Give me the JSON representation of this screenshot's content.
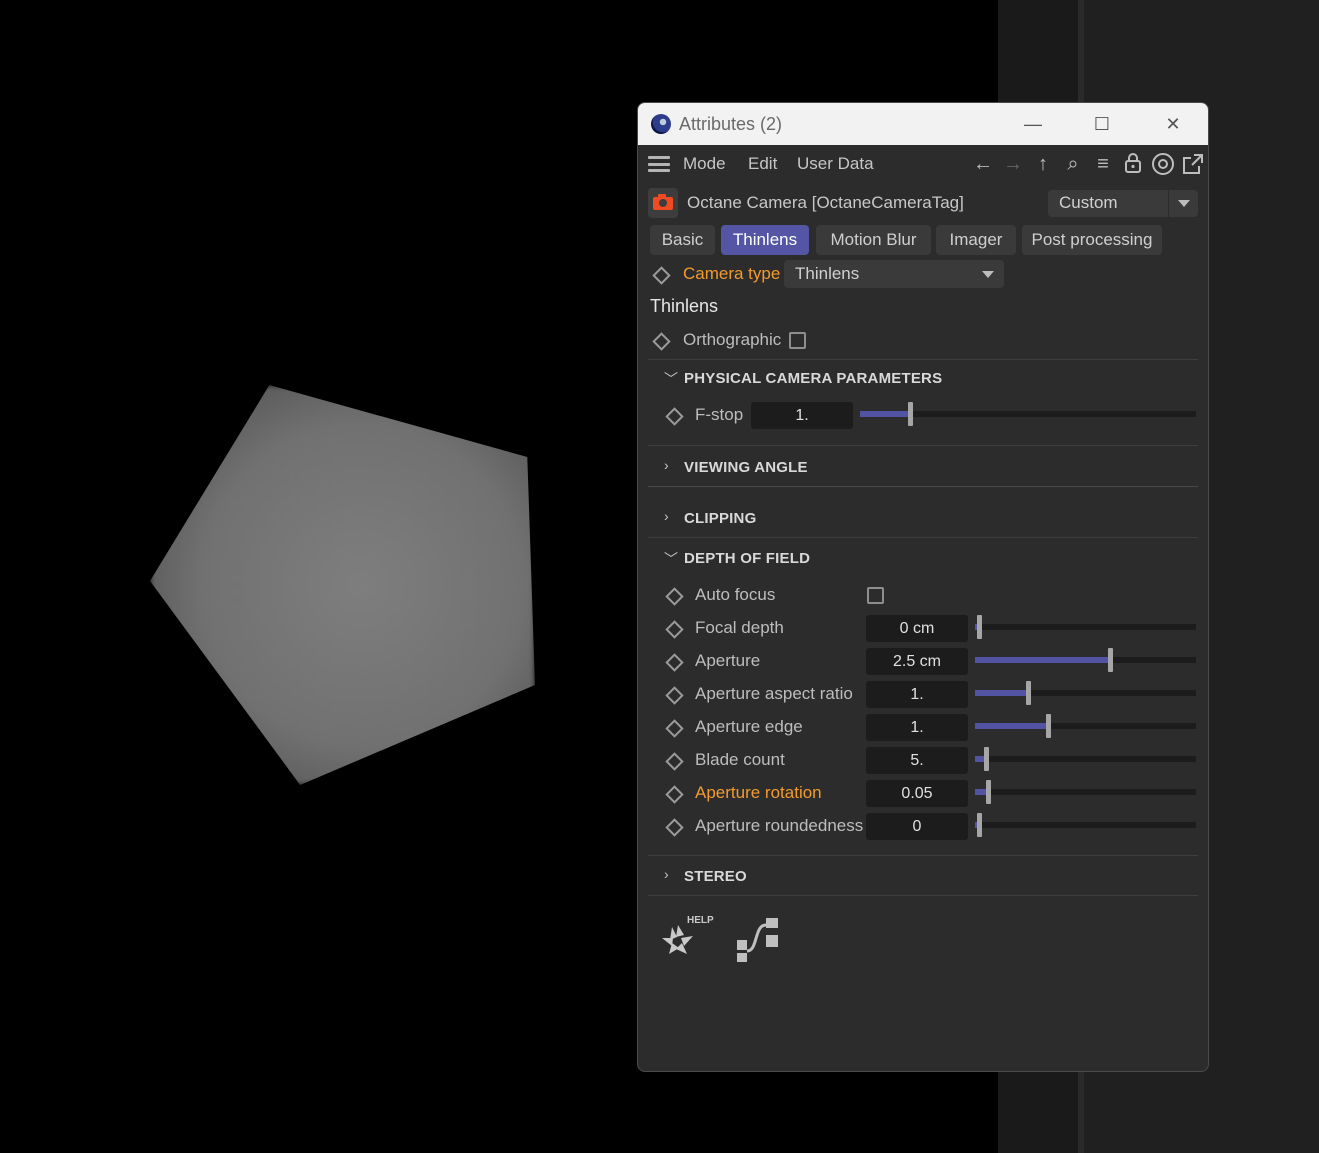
{
  "window": {
    "title": "Attributes (2)",
    "minimize": "—",
    "maximize": "☐",
    "close": "✕"
  },
  "menu": {
    "mode": "Mode",
    "edit": "Edit",
    "user_data": "User Data"
  },
  "toolbar": {
    "back": "←",
    "forward": "→",
    "up": "↑",
    "search": "⌕",
    "filter": "≡",
    "lock": "🔒",
    "target": "◎",
    "new_window": "⇱"
  },
  "object": {
    "name": "Octane Camera [OctaneCameraTag]",
    "preset": "Custom"
  },
  "tabs": [
    {
      "label": "Basic",
      "active": false
    },
    {
      "label": "Thinlens",
      "active": true
    },
    {
      "label": "Motion Blur",
      "active": false
    },
    {
      "label": "Imager",
      "active": false
    },
    {
      "label": "Post processing",
      "active": false
    }
  ],
  "camera_type": {
    "label": "Camera type",
    "value": "Thinlens"
  },
  "section_title": "Thinlens",
  "orthographic": {
    "label": "Orthographic",
    "checked": false
  },
  "physical": {
    "header": "PHYSICAL CAMERA PARAMETERS",
    "fstop": {
      "label": "F-stop",
      "value": "1.",
      "fraction": 0.15
    }
  },
  "viewing_angle": {
    "header": "VIEWING ANGLE"
  },
  "clipping": {
    "header": "CLIPPING"
  },
  "dof": {
    "header": "DEPTH OF FIELD",
    "auto_focus": {
      "label": "Auto focus",
      "checked": false
    },
    "rows": [
      {
        "label": "Focal depth",
        "value": "0 cm",
        "fraction": 0.02,
        "orange": false
      },
      {
        "label": "Aperture",
        "value": "2.5 cm",
        "fraction": 0.61,
        "orange": false
      },
      {
        "label": "Aperture aspect ratio",
        "value": "1.",
        "fraction": 0.24,
        "orange": false
      },
      {
        "label": "Aperture edge",
        "value": "1.",
        "fraction": 0.33,
        "orange": false
      },
      {
        "label": "Blade count",
        "value": "5.",
        "fraction": 0.05,
        "orange": false
      },
      {
        "label": "Aperture rotation",
        "value": "0.05",
        "fraction": 0.06,
        "orange": true
      },
      {
        "label": "Aperture roundedness",
        "value": "0",
        "fraction": 0.02,
        "orange": false
      }
    ]
  },
  "stereo": {
    "header": "STEREO"
  },
  "help_badge": "HELP",
  "colors": {
    "accent": "#5455a4",
    "highlight_label": "#f39a2e",
    "camera_icon": "#f04a23"
  }
}
